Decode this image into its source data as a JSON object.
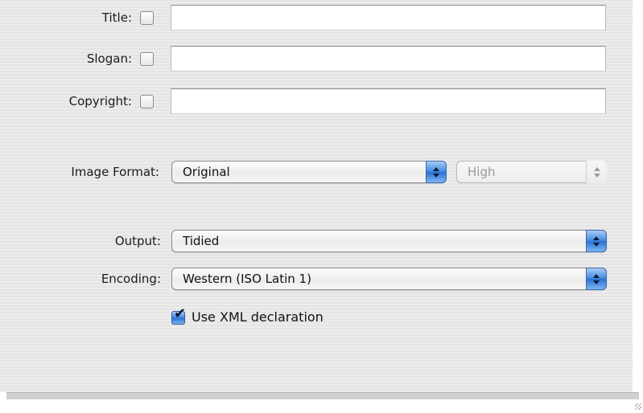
{
  "fields": {
    "title": {
      "label": "Title:",
      "checked": false,
      "value": ""
    },
    "slogan": {
      "label": "Slogan:",
      "checked": false,
      "value": ""
    },
    "copyright": {
      "label": "Copyright:",
      "checked": false,
      "value": ""
    }
  },
  "image_format": {
    "label": "Image Format:",
    "format_value": "Original",
    "quality_value": "High",
    "quality_enabled": false
  },
  "output": {
    "label": "Output:",
    "value": "Tidied"
  },
  "encoding": {
    "label": "Encoding:",
    "value": "Western (ISO Latin 1)"
  },
  "xml_declaration": {
    "label": "Use XML declaration",
    "checked": true
  },
  "icons": {
    "popup_arrows": "up-down-arrows-icon",
    "checkmark": "checkmark-icon",
    "grow": "resize-grip-icon"
  },
  "colors": {
    "accent": "#3f86e0",
    "panel": "#e9e9e9"
  }
}
